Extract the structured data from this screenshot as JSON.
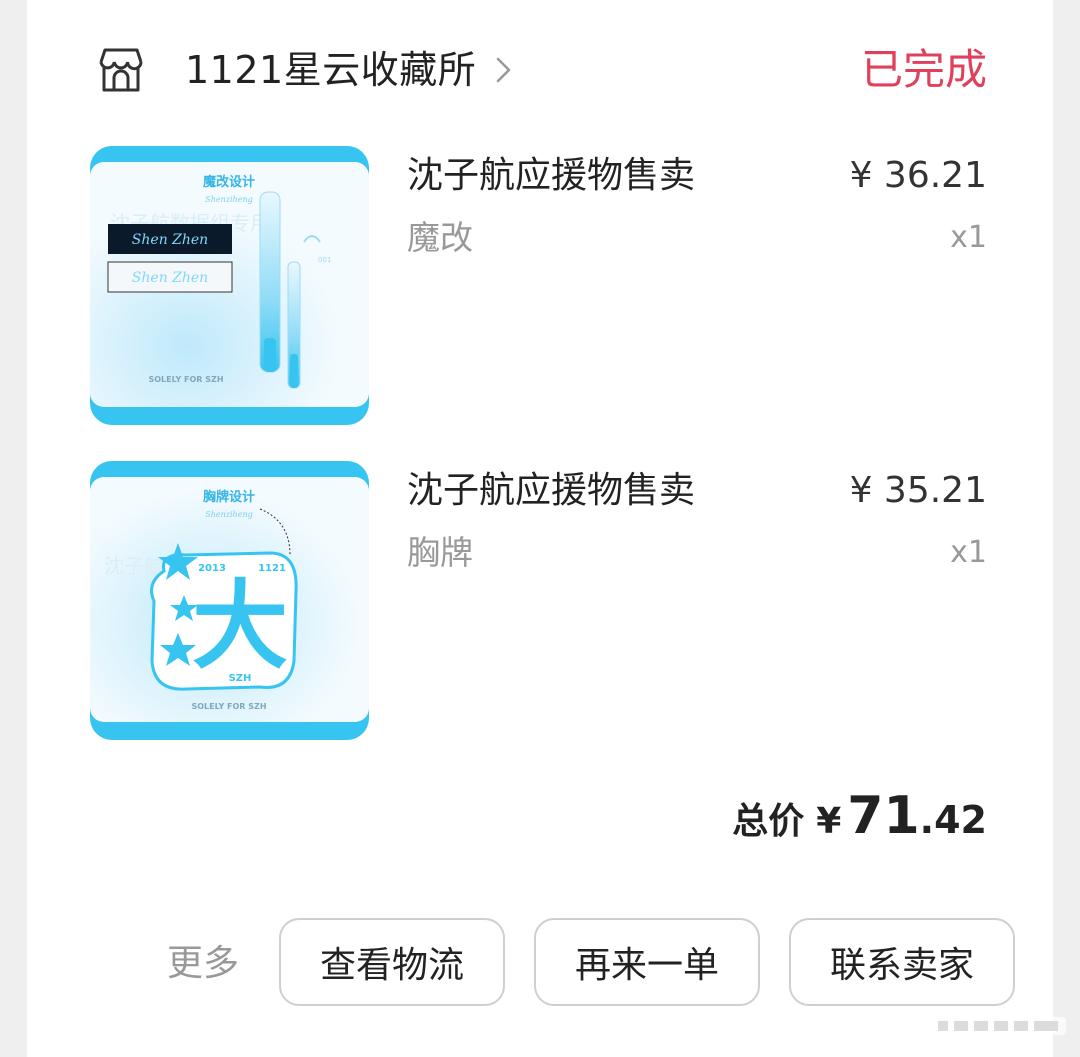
{
  "shop": {
    "name": "1121星云收藏所",
    "icon": "storefront-icon",
    "status": "已完成"
  },
  "items": [
    {
      "title": "沈子航应援物售卖",
      "spec": "魔改",
      "price": "¥ 36.21",
      "qty": "x1",
      "thumb": {
        "heading": "魔改设计",
        "script": "Shenziheng",
        "watermark": "沈子航数据组专用",
        "footer": "SOLELY FOR SZH",
        "badge": "001"
      }
    },
    {
      "title": "沈子航应援物售卖",
      "spec": "胸牌",
      "price": "¥ 35.21",
      "qty": "x1",
      "thumb": {
        "heading": "胸牌设计",
        "script": "Shenziheng",
        "watermark": "沈子航数据组专用",
        "year": "2013",
        "date": "1121",
        "glyph": "大",
        "initials": "SZH",
        "footer": "SOLELY FOR SZH"
      }
    }
  ],
  "total": {
    "label": "总价",
    "currency": "¥",
    "integer": "71",
    "decimal": ".42"
  },
  "footer": {
    "more": "更多",
    "buttons": [
      "查看物流",
      "再来一单",
      "联系卖家"
    ]
  },
  "colors": {
    "status": "#e0405c",
    "thumb_accent": "#37c4f0"
  }
}
